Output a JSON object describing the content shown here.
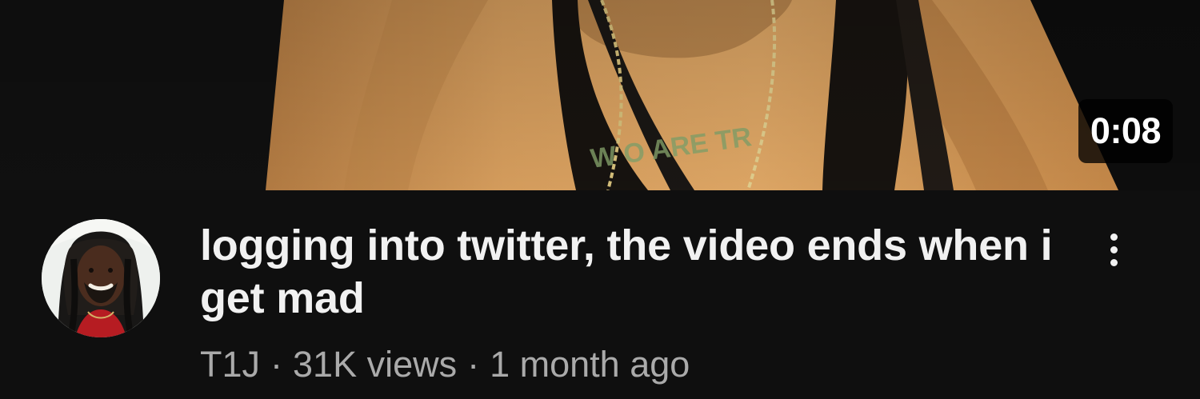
{
  "video": {
    "duration": "0:08",
    "title": "logging into twitter, the video ends when i get mad",
    "channel": "T1J",
    "views": "31K views",
    "age": "1 month ago",
    "separator": "·"
  },
  "icons": {
    "more": "more-vert-icon"
  },
  "colors": {
    "background": "#0f0f0f",
    "title": "#f1f1f1",
    "metadata": "#aaaaaa",
    "duration_badge": "#000000",
    "thumbnail_shirt": "#d89e5b"
  }
}
